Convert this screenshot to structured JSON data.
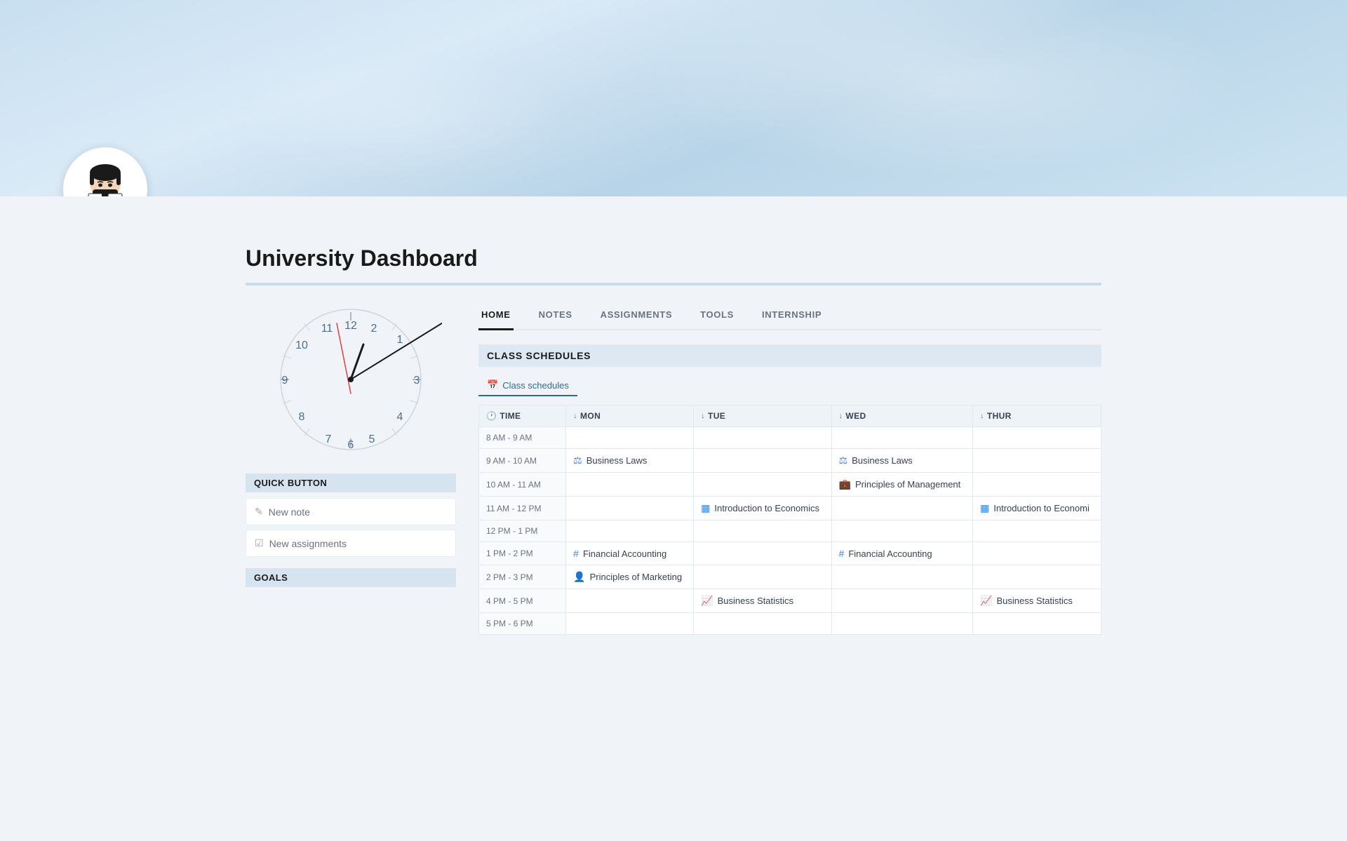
{
  "hero": {
    "alt": "Sky background"
  },
  "avatar": {
    "alt": "Student reading avatar"
  },
  "page_title": "University Dashboard",
  "nav": {
    "tabs": [
      {
        "label": "HOME",
        "active": true
      },
      {
        "label": "NOTES",
        "active": false
      },
      {
        "label": "ASSIGNMENTS",
        "active": false
      },
      {
        "label": "TOOLS",
        "active": false
      },
      {
        "label": "INTERNSHIP",
        "active": false
      }
    ]
  },
  "sections": {
    "class_schedules": "CLASS SCHEDULES",
    "quick_button": "QUICK BUTTON",
    "goals": "GOALS"
  },
  "calendar_tab": "Class schedules",
  "quick_buttons": [
    {
      "label": "New note",
      "icon": "✎"
    },
    {
      "label": "New assignments",
      "icon": "☑"
    }
  ],
  "schedule": {
    "columns": [
      {
        "label": "TIME",
        "icon": "🕐"
      },
      {
        "label": "MON",
        "arrow": "↓"
      },
      {
        "label": "TUE",
        "arrow": "↓"
      },
      {
        "label": "WED",
        "arrow": "↓"
      },
      {
        "label": "THUR",
        "arrow": "↓"
      }
    ],
    "rows": [
      {
        "time": "8 AM - 9 AM",
        "mon": null,
        "tue": null,
        "wed": null,
        "thur": null
      },
      {
        "time": "9 AM - 10 AM",
        "mon": {
          "name": "Business Laws",
          "icon": "⚖",
          "type": "law"
        },
        "tue": null,
        "wed": {
          "name": "Business Laws",
          "icon": "⚖",
          "type": "law"
        },
        "thur": null
      },
      {
        "time": "10 AM - 11 AM",
        "mon": null,
        "tue": null,
        "wed": {
          "name": "Principles of Management",
          "icon": "💼",
          "type": "mgmt"
        },
        "thur": null
      },
      {
        "time": "11 AM - 12 PM",
        "mon": null,
        "tue": {
          "name": "Introduction to Economics",
          "icon": "▦",
          "type": "econ"
        },
        "wed": null,
        "thur": {
          "name": "Introduction to Economi",
          "icon": "▦",
          "type": "econ"
        }
      },
      {
        "time": "12 PM - 1 PM",
        "mon": null,
        "tue": null,
        "wed": null,
        "thur": null
      },
      {
        "time": "1 PM - 2 PM",
        "mon": {
          "name": "Financial Accounting",
          "icon": "#",
          "type": "acct"
        },
        "tue": null,
        "wed": {
          "name": "Financial Accounting",
          "icon": "#",
          "type": "acct"
        },
        "thur": null
      },
      {
        "time": "2 PM - 3 PM",
        "mon": {
          "name": "Principles of Marketing",
          "icon": "👤",
          "type": "mktg"
        },
        "tue": null,
        "wed": null,
        "thur": null
      },
      {
        "time": "4 PM - 5 PM",
        "mon": null,
        "tue": {
          "name": "Business Statistics",
          "icon": "📈",
          "type": "stat"
        },
        "wed": null,
        "thur": {
          "name": "Business Statistics",
          "icon": "📈",
          "type": "stat"
        }
      },
      {
        "time": "5 PM - 6 PM",
        "mon": null,
        "tue": null,
        "wed": null,
        "thur": null
      }
    ]
  }
}
